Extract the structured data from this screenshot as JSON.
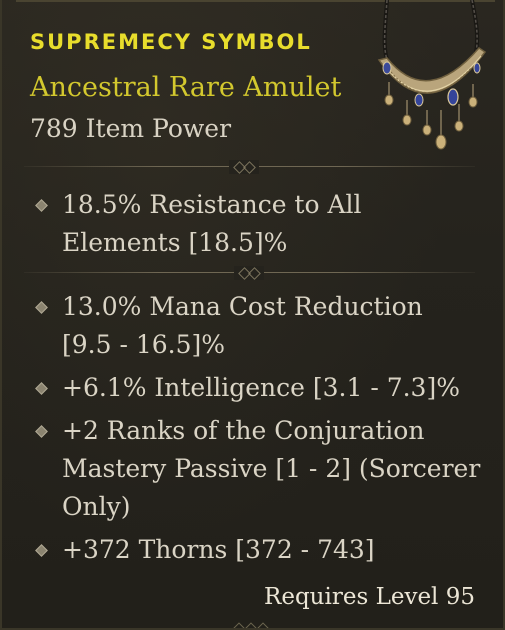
{
  "item": {
    "name": "SUPREMECY SYMBOL",
    "type": "Ancestral Rare Amulet",
    "power": "789 Item Power"
  },
  "implicit_affixes": [
    {
      "line1": "18.5% Resistance to All",
      "line2": "Elements [18.5]%"
    }
  ],
  "affixes": [
    {
      "line1": "13.0% Mana Cost Reduction",
      "line2": "[9.5 - 16.5]%"
    },
    {
      "line1": "+6.1% Intelligence [3.1 - 7.3]%"
    },
    {
      "line1": "+2 Ranks of the Conjuration",
      "line2": "Mastery Passive [1 - 2] (Sorcerer",
      "line3": "Only)"
    },
    {
      "line1": "+372 Thorns [372 - 743]"
    }
  ],
  "requirement": "Requires Level 95",
  "icons": {
    "amulet": "amulet-icon",
    "bullet": "diamond-bullet-icon"
  },
  "colors": {
    "rare_name": "#e8dd2c",
    "rare_type": "#d3c82e",
    "text": "#dad4c5",
    "background": "#25231d"
  }
}
